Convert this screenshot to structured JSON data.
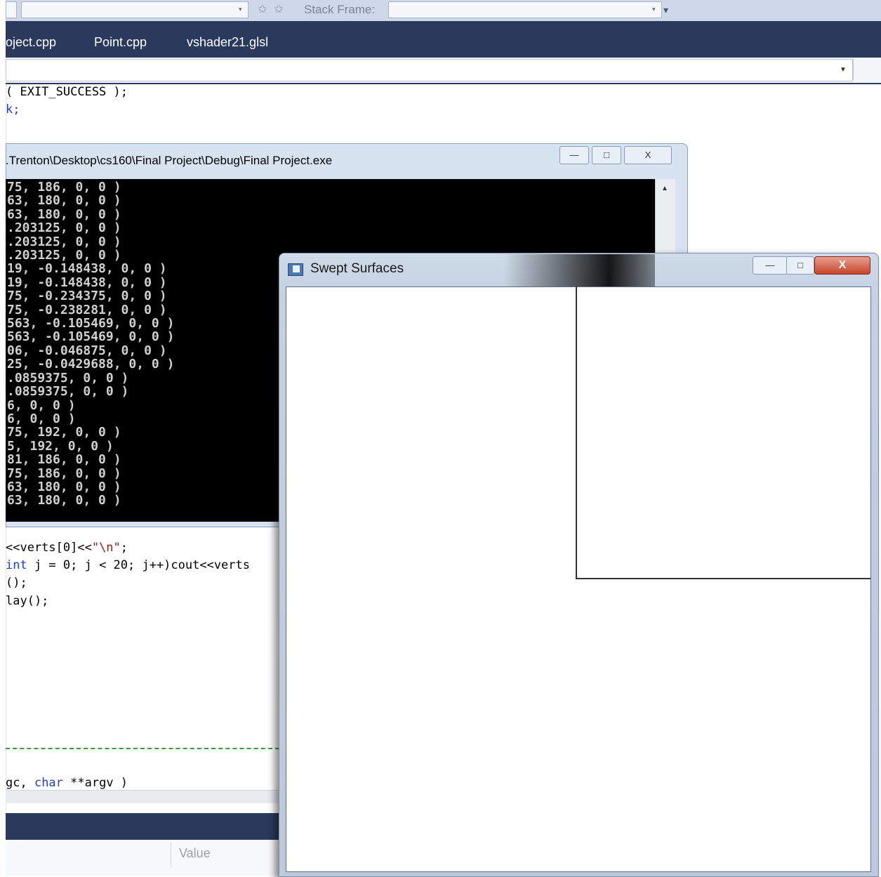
{
  "ide": {
    "toolbar": {
      "stack_frame_label": "Stack Frame:"
    },
    "tabs": [
      "oject.cpp",
      "Point.cpp",
      "vshader21.glsl"
    ],
    "code_top": [
      "( EXIT_SUCCESS );",
      "k;"
    ],
    "code_bottom": {
      "line1": "<<verts[0]<<",
      "line1_str": "\"\\n\"",
      "line1_end": ";",
      "line2_kw": "int",
      "line2": " j = 0; j < 20; j++)cout<<verts",
      "line3": "();",
      "line4": "lay();",
      "line5_pre": "gc, ",
      "line5_kw": "char",
      "line5_post": " **argv )"
    },
    "bottom_panel": {
      "value_header": "Value"
    }
  },
  "console": {
    "title": ".Trenton\\Desktop\\cs160\\Final Project\\Debug\\Final Project.exe",
    "lines": [
      "75, 186, 0, 0 )",
      "63, 180, 0, 0 )",
      "63, 180, 0, 0 )",
      ".203125, 0, 0 )",
      ".203125, 0, 0 )",
      ".203125, 0, 0 )",
      "19, -0.148438, 0, 0 )",
      "19, -0.148438, 0, 0 )",
      "75, -0.234375, 0, 0 )",
      "75, -0.238281, 0, 0 )",
      "563, -0.105469, 0, 0 )",
      "563, -0.105469, 0, 0 )",
      "06, -0.046875, 0, 0 )",
      "25, -0.0429688, 0, 0 )",
      ".0859375, 0, 0 )",
      ".0859375, 0, 0 )",
      "6, 0, 0 )",
      "6, 0, 0 )",
      "75, 192, 0, 0 )",
      "5, 192, 0, 0 )",
      "81, 186, 0, 0 )",
      "75, 186, 0, 0 )",
      "63, 180, 0, 0 )",
      "63, 180, 0, 0 )"
    ]
  },
  "swept_window": {
    "title": "Swept Surfaces",
    "close_glyph": "X",
    "min_glyph": "—",
    "max_glyph": "□",
    "close_icon_color": "#c8422a"
  }
}
